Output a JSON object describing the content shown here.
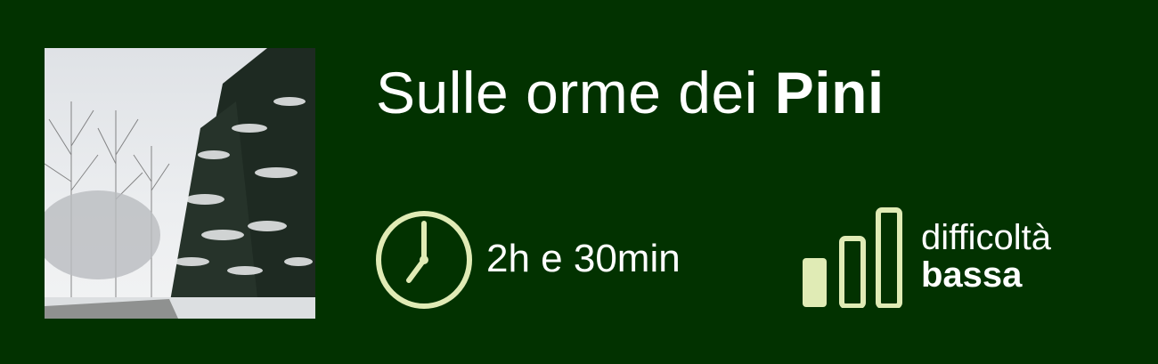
{
  "title": {
    "regular": "Sulle orme dei ",
    "bold": "Pini"
  },
  "duration": {
    "icon": "clock-icon",
    "text": "2h e 30min"
  },
  "difficulty": {
    "icon": "signal-bars-icon",
    "label": "difficoltà",
    "value": "bassa",
    "level": 1,
    "max_level": 3
  },
  "colors": {
    "background": "#023200",
    "accent": "#e0ebb5",
    "text": "#ffffff"
  }
}
